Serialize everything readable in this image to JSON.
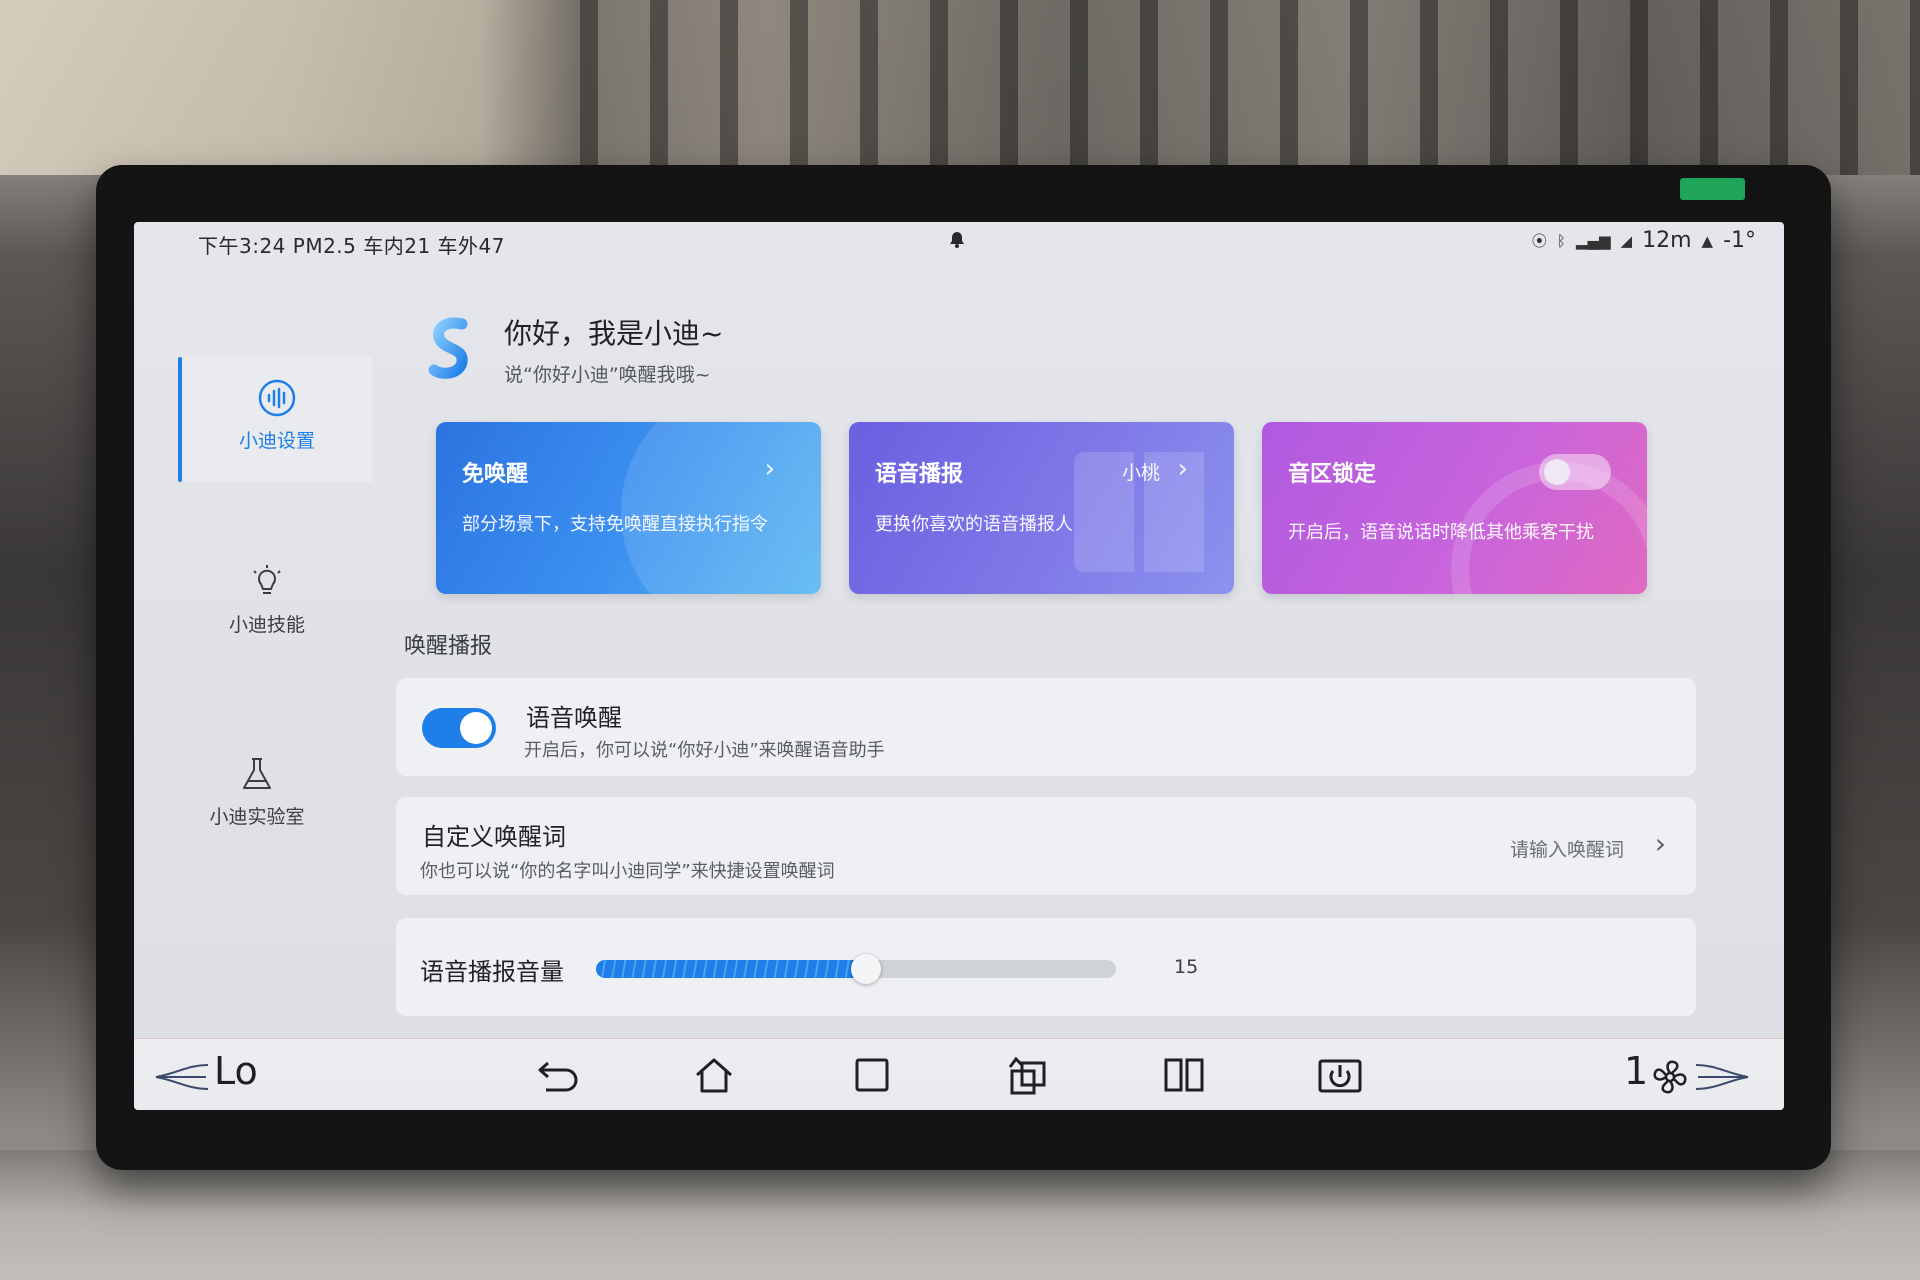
{
  "status_bar": {
    "left": "下午3:24  PM2.5  车内21  车外47",
    "right_distance": "12m",
    "right_temp": "-1°"
  },
  "assistant": {
    "greeting": "你好，我是小迪~",
    "sub_greeting": "说“你好小迪”唤醒我哦~"
  },
  "sidebar": {
    "items": [
      {
        "label": "小迪设置",
        "icon": "voice-wave-icon",
        "active": true
      },
      {
        "label": "小迪技能",
        "icon": "lightbulb-icon",
        "active": false
      },
      {
        "label": "小迪实验室",
        "icon": "flask-icon",
        "active": false
      }
    ]
  },
  "cards": [
    {
      "title": "免唤醒",
      "desc": "部分场景下，支持免唤醒直接执行指令",
      "extra": "",
      "has_chevron": true
    },
    {
      "title": "语音播报",
      "desc": "更换你喜欢的语音播报人",
      "extra": "小桃",
      "has_chevron": true
    },
    {
      "title": "音区锁定",
      "desc": "开启后，语音说话时降低其他乘客干扰",
      "toggle_on": false
    }
  ],
  "section": {
    "title": "唤醒播报"
  },
  "rows": {
    "voice_wake": {
      "title": "语音唤醒",
      "desc": "开启后，你可以说“你好小迪”来唤醒语音助手",
      "toggle_on": true
    },
    "custom_wake": {
      "title": "自定义唤醒词",
      "desc": "你也可以说“你的名字叫小迪同学”来快捷设置唤醒词",
      "placeholder": "请输入唤醒词"
    },
    "volume": {
      "title": "语音播报音量",
      "value": "15",
      "fraction": 0.52
    }
  },
  "navbar": {
    "left_temp": "Lo",
    "fan_level": "1"
  },
  "colors": {
    "accent": "#1f7fe8",
    "card1": "#3b8ff0",
    "card2": "#7f78e8",
    "card3": "#c864dc"
  }
}
